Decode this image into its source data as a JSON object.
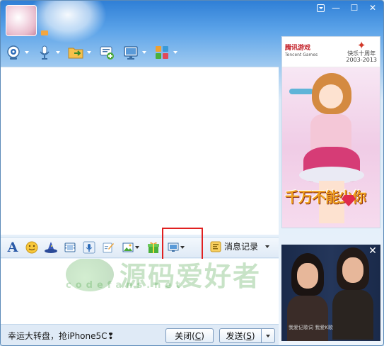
{
  "window": {
    "controls": [
      "▣",
      "—",
      "☐",
      "✕"
    ]
  },
  "toolbar": {
    "items": [
      {
        "name": "video-call",
        "icon": "webcam-icon"
      },
      {
        "name": "voice-call",
        "icon": "microphone-icon"
      },
      {
        "name": "send-file",
        "icon": "folder-icon"
      },
      {
        "name": "create-group",
        "icon": "add-chat-icon"
      },
      {
        "name": "remote-assist",
        "icon": "monitor-icon"
      },
      {
        "name": "apps",
        "icon": "apps-grid-icon"
      }
    ]
  },
  "ad_top": {
    "logo_left": "腾讯游戏",
    "logo_left_sub": "Tencent Games",
    "logo_right": "快乐十周年",
    "logo_right_sub": "2003-2013",
    "slogan": "千万不能少你"
  },
  "ad_bottom": {
    "caption": "我爱记歌词 我爱K歌"
  },
  "format_toolbar": {
    "history_label": "消息记录"
  },
  "watermark": {
    "text": "源码爱好者",
    "sub": "codefans.net"
  },
  "bottom": {
    "promo": "幸运大转盘，抢iPhone5C❢",
    "close_label": "关闭(",
    "close_key": "C",
    "close_end": ")",
    "send_label": "发送(",
    "send_key": "S",
    "send_end": ")"
  },
  "colors": {
    "accent": "#2f7fd6",
    "highlight_box": "#e02020"
  }
}
